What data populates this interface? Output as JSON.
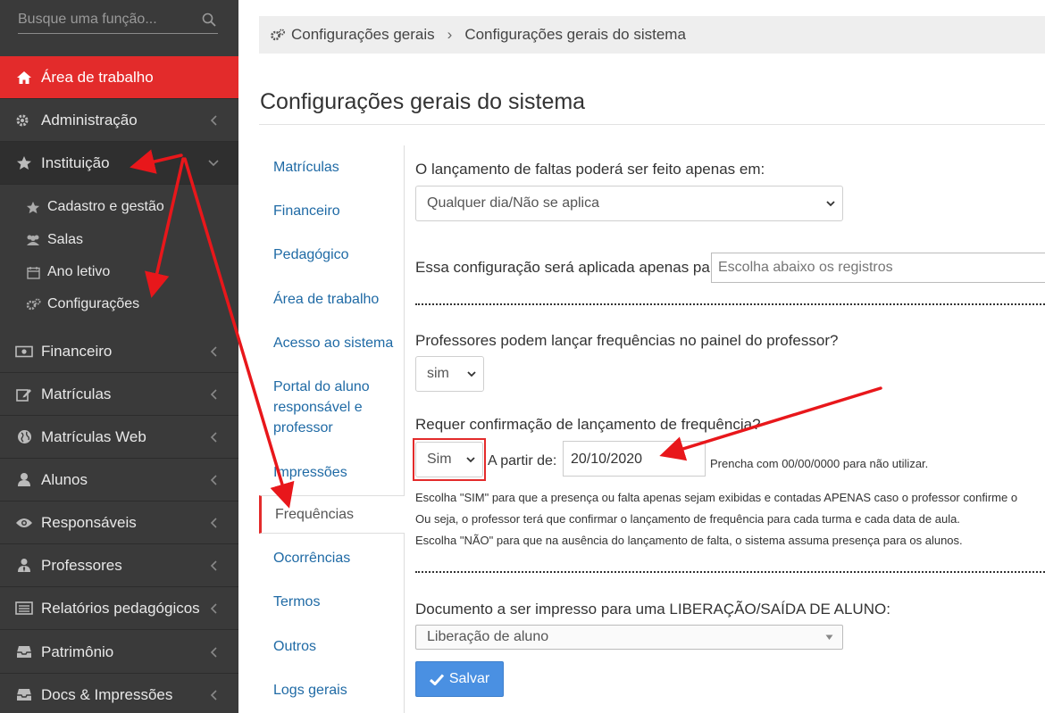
{
  "sidebar": {
    "search_placeholder": "Busque uma função...",
    "items": [
      {
        "label": "Área de trabalho",
        "icon": "home-icon"
      },
      {
        "label": "Administração",
        "icon": "gears-icon"
      },
      {
        "label": "Instituição",
        "icon": "star-icon"
      },
      {
        "label": "Financeiro",
        "icon": "money-icon"
      },
      {
        "label": "Matrículas",
        "icon": "edit-icon"
      },
      {
        "label": "Matrículas Web",
        "icon": "globe-icon"
      },
      {
        "label": "Alunos",
        "icon": "user-icon"
      },
      {
        "label": "Responsáveis",
        "icon": "eye-icon"
      },
      {
        "label": "Professores",
        "icon": "teacher-icon"
      },
      {
        "label": "Relatórios pedagógicos",
        "icon": "list-icon"
      },
      {
        "label": "Patrimônio",
        "icon": "inbox-icon"
      },
      {
        "label": "Docs & Impressões",
        "icon": "inbox-icon"
      }
    ],
    "submenu": [
      {
        "label": "Cadastro e gestão",
        "icon": "star-icon"
      },
      {
        "label": "Salas",
        "icon": "users-icon"
      },
      {
        "label": "Ano letivo",
        "icon": "calendar-icon"
      },
      {
        "label": "Configurações",
        "icon": "gears-icon"
      }
    ]
  },
  "breadcrumb": {
    "root": "Configurações gerais",
    "current": "Configurações gerais do sistema"
  },
  "page_title": "Configurações gerais do sistema",
  "tabs": [
    "Matrículas",
    "Financeiro",
    "Pedagógico",
    "Área de trabalho",
    "Acesso ao sistema",
    "Portal do aluno responsável e professor",
    "Impressões",
    "Frequências",
    "Ocorrências",
    "Termos",
    "Outros",
    "Logs gerais"
  ],
  "active_tab": "Frequências",
  "form": {
    "q1": "O lançamento de faltas poderá ser feito apenas em:",
    "q1_value": "Qualquer dia/Não se aplica",
    "q2": "Essa configuração será aplicada apenas para:",
    "q2_placeholder": "Escolha abaixo os registros",
    "q3": "Professores podem lançar frequências no painel do professor?",
    "q3_value": "sim",
    "q4": "Requer confirmação de lançamento de frequência?",
    "q4_value": "Sim",
    "q4_from_label": "A partir de:",
    "q4_date": "20/10/2020",
    "q4_date_hint": "Prencha com 00/00/0000 para não utilizar.",
    "help_1": "Escolha \"SIM\" para que a presença ou falta apenas sejam exibidas e contadas APENAS caso o professor confirme o",
    "help_2": "Ou seja, o professor terá que confirmar o lançamento de frequência para cada turma e cada data de aula.",
    "help_3": "Escolha \"NÃO\" para que na ausência do lançamento de falta, o sistema assuma presença para os alunos.",
    "q5": "Documento a ser impresso para uma LIBERAÇÃO/SAÍDA DE ALUNO:",
    "q5_value": "Liberação de aluno",
    "save_label": "Salvar"
  },
  "colors": {
    "sidebar_bg": "#3a3a3a",
    "accent_red": "#e32b2b",
    "link_blue": "#1f6aa5",
    "save_button": "#4a90e2",
    "annotation_arrow": "#e8171b"
  }
}
